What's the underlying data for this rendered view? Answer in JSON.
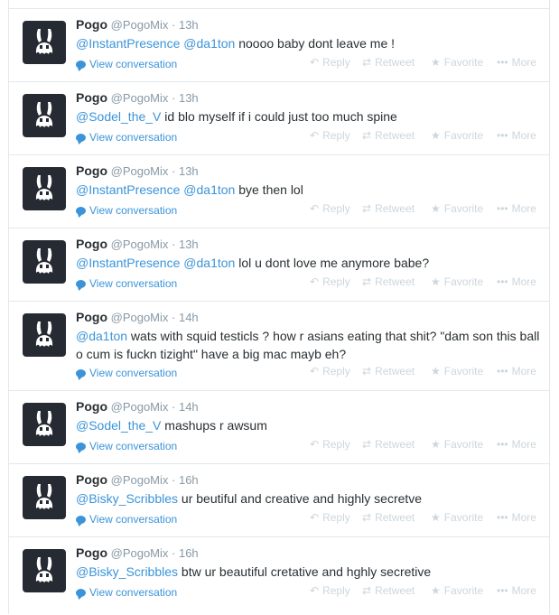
{
  "actions": {
    "reply": "Reply",
    "retweet": "Retweet",
    "favorite": "Favorite",
    "more": "More",
    "view_conversation": "View conversation"
  },
  "tweets": [
    {
      "name": "Pogo",
      "handle": "@PogoMix",
      "time": "13h",
      "parts": [
        {
          "m": "@InstantPresence"
        },
        {
          "t": " "
        },
        {
          "m": "@da1ton"
        },
        {
          "t": " noooo baby dont leave me !"
        }
      ]
    },
    {
      "name": "Pogo",
      "handle": "@PogoMix",
      "time": "13h",
      "parts": [
        {
          "m": "@Sodel_the_V"
        },
        {
          "t": " id blo myself if i could just too much spine"
        }
      ]
    },
    {
      "name": "Pogo",
      "handle": "@PogoMix",
      "time": "13h",
      "parts": [
        {
          "m": "@InstantPresence"
        },
        {
          "t": " "
        },
        {
          "m": "@da1ton"
        },
        {
          "t": " bye then lol"
        }
      ]
    },
    {
      "name": "Pogo",
      "handle": "@PogoMix",
      "time": "13h",
      "parts": [
        {
          "m": "@InstantPresence"
        },
        {
          "t": " "
        },
        {
          "m": "@da1ton"
        },
        {
          "t": " lol u dont love me anymore babe?"
        }
      ]
    },
    {
      "name": "Pogo",
      "handle": "@PogoMix",
      "time": "14h",
      "parts": [
        {
          "m": "@da1ton"
        },
        {
          "t": " wats with squid testicls ? how r asians eating that shit? \"dam son this ball o cum is fuckn tizight\" have a big mac mayb eh?"
        }
      ]
    },
    {
      "name": "Pogo",
      "handle": "@PogoMix",
      "time": "14h",
      "parts": [
        {
          "m": "@Sodel_the_V"
        },
        {
          "t": " mashups r awsum"
        }
      ]
    },
    {
      "name": "Pogo",
      "handle": "@PogoMix",
      "time": "16h",
      "parts": [
        {
          "m": "@Bisky_Scribbles"
        },
        {
          "t": " ur beutiful and creative and highly secretve"
        }
      ]
    },
    {
      "name": "Pogo",
      "handle": "@PogoMix",
      "time": "16h",
      "parts": [
        {
          "m": "@Bisky_Scribbles"
        },
        {
          "t": " btw ur beautiful cretative and hghly secretive"
        }
      ]
    }
  ]
}
